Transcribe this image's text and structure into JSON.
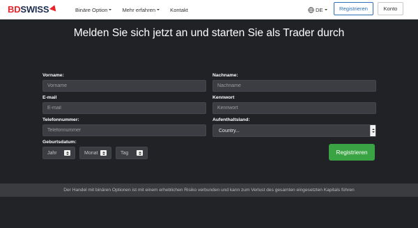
{
  "header": {
    "logo_bd": "BD",
    "logo_swiss": "SWISS",
    "nav": [
      {
        "label": "Binäre Option",
        "has_caret": true
      },
      {
        "label": "Mehr erfahren",
        "has_caret": true
      },
      {
        "label": "Kontakt",
        "has_caret": false
      }
    ],
    "language": "DE",
    "register_label": "Registrieren",
    "account_label": "Konto"
  },
  "form": {
    "headline": "Melden Sie sich jetzt an und starten Sie als Trader durch",
    "first_name": {
      "label": "Vorname:",
      "placeholder": "Vorname"
    },
    "last_name": {
      "label": "Nachname:",
      "placeholder": "Nachname"
    },
    "email": {
      "label": "E-mail",
      "placeholder": "E-mail"
    },
    "password": {
      "label": "Kennwort",
      "placeholder": "Kennwort"
    },
    "phone": {
      "label": "Telefonnummer:",
      "placeholder": "Telefonnummer"
    },
    "country": {
      "label": "Aufenthaltsland:",
      "value": "Country..."
    },
    "birthdate": {
      "label": "Geburtsdatum:",
      "year": "Jahr",
      "month": "Monat",
      "day": "Tag"
    },
    "submit_label": "Registrieren"
  },
  "footer": {
    "risk_warning": "Der Handel mit binären Optionen ist mit einem erheblichen Risiko verbunden und kann zum Verlust des gesamten eingesetzten Kapitals führen"
  },
  "colors": {
    "brand_red": "#e8232a",
    "brand_navy": "#1d2b4f",
    "accent_blue": "#2c6fb5",
    "submit_green": "#3aa444",
    "background": "#202226"
  }
}
